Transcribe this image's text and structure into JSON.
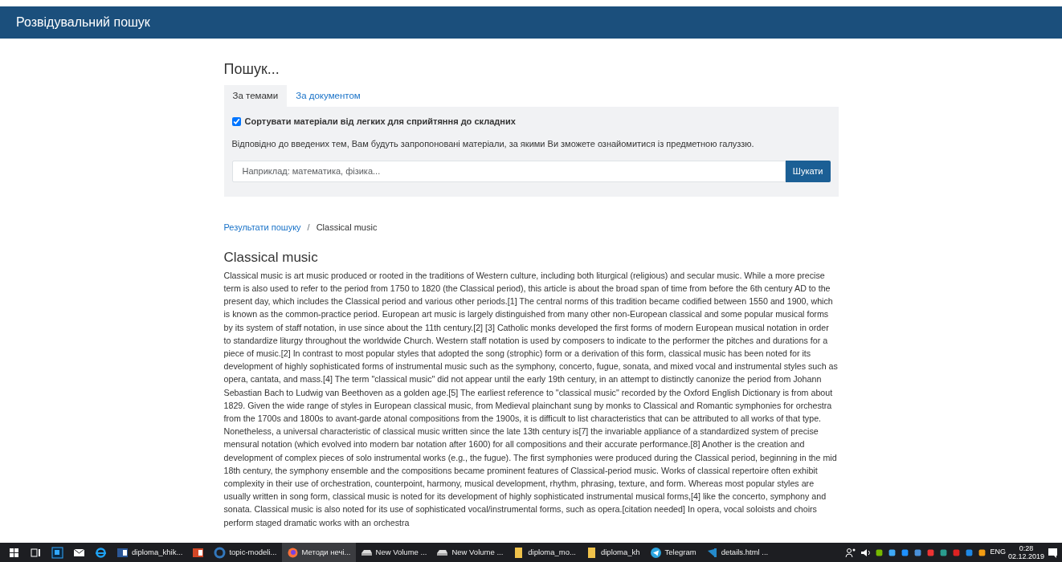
{
  "navbar": {
    "title": "Розвідувальний пошук"
  },
  "search_panel": {
    "heading": "Пошук...",
    "tabs": [
      {
        "label": "За темами",
        "selected": true
      },
      {
        "label": "За документом",
        "selected": false
      }
    ],
    "sort_option": {
      "label": "Сортувати матеріали від легких для сприйтяння до складних",
      "checked": true
    },
    "description": "Відповідно до введених тем, Вам будуть запропоновані матеріали, за якими Ви зможете ознайомитися із предметною галуззю.",
    "search": {
      "placeholder": "Наприклад: математика, фізика..."
    },
    "button": "Шукати"
  },
  "breadcrumb": {
    "separator": "/",
    "items": [
      {
        "label": "Результати пошуку",
        "link": true
      },
      {
        "label": "Classical music",
        "link": false
      }
    ]
  },
  "article": {
    "title": "Classical music",
    "body": "Classical music is art music produced or rooted in the traditions of Western culture, including both liturgical (religious) and secular music. While a more precise term is also used to refer to the period from 1750 to 1820 (the Classical period), this article is about the broad span of time from before the 6th century AD to the present day, which includes the Classical period and various other periods.[1] The central norms of this tradition became codified between 1550 and 1900, which is known as the common-practice period. European art music is largely distinguished from many other non-European classical and some popular musical forms by its system of staff notation, in use since about the 11th century.[2] [3] Catholic monks developed the first forms of modern European musical notation in order to standardize liturgy throughout the worldwide Church. Western staff notation is used by composers to indicate to the performer the pitches and durations for a piece of music.[2] In contrast to most popular styles that adopted the song (strophic) form or a derivation of this form, classical music has been noted for its development of highly sophisticated forms of instrumental music such as the symphony, concerto, fugue, sonata, and mixed vocal and instrumental styles such as opera, cantata, and mass.[4] The term \"classical music\" did not appear until the early 19th century, in an attempt to distinctly canonize the period from Johann Sebastian Bach to Ludwig van Beethoven as a golden age.[5] The earliest reference to \"classical music\" recorded by the Oxford English Dictionary is from about 1829. Given the wide range of styles in European classical music, from Medieval plainchant sung by monks to Classical and Romantic symphonies for orchestra from the 1700s and 1800s to avant-garde atonal compositions from the 1900s, it is difficult to list characteristics that can be attributed to all works of that type. Nonetheless, a universal characteristic of classical music written since the late 13th century is[7] the invariable appliance of a standardized system of precise mensural notation (which evolved into modern bar notation after 1600) for all compositions and their accurate performance.[8] Another is the creation and development of complex pieces of solo instrumental works (e.g., the fugue). The first symphonies were produced during the Classical period, beginning in the mid 18th century, the symphony ensemble and the compositions became prominent features of Classical-period music. Works of classical repertoire often exhibit complexity in their use of orchestration, counterpoint, harmony, musical development, rhythm, phrasing, texture, and form. Whereas most popular styles are usually written in song form, classical music is noted for its development of highly sophisticated instrumental musical forms,[4] like the concerto, symphony and sonata. Classical music is also noted for its use of sophisticated vocal/instrumental forms, such as opera.[citation needed] In opera, vocal soloists and choirs perform staged dramatic works with an orchestra"
  },
  "taskbar": {
    "items": [
      {
        "kind": "start",
        "selected": false
      },
      {
        "kind": "taskview",
        "selected": false
      },
      {
        "kind": "ps",
        "selected": false
      },
      {
        "kind": "mail",
        "selected": false
      },
      {
        "kind": "ie",
        "selected": false
      },
      {
        "kind": "word",
        "label": "diploma_khik...",
        "selected": false
      },
      {
        "kind": "ppt",
        "selected": false
      },
      {
        "kind": "edge",
        "label": "topic-modeli...",
        "selected": false
      },
      {
        "kind": "firefox",
        "label": "Методи нечі...",
        "selected": true
      },
      {
        "kind": "drive",
        "label": "New Volume ...",
        "selected": false
      },
      {
        "kind": "drive",
        "label": "New Volume ...",
        "selected": false
      },
      {
        "kind": "folder",
        "label": "diploma_mo...",
        "selected": false
      },
      {
        "kind": "folder",
        "label": "diploma_kh",
        "selected": false
      },
      {
        "kind": "telegram",
        "label": "Telegram",
        "selected": false
      },
      {
        "kind": "vscode",
        "label": "details.html ...",
        "selected": false
      }
    ],
    "tray": {
      "language": "ENG",
      "time": "0:28",
      "date": "02.12.2019"
    }
  }
}
